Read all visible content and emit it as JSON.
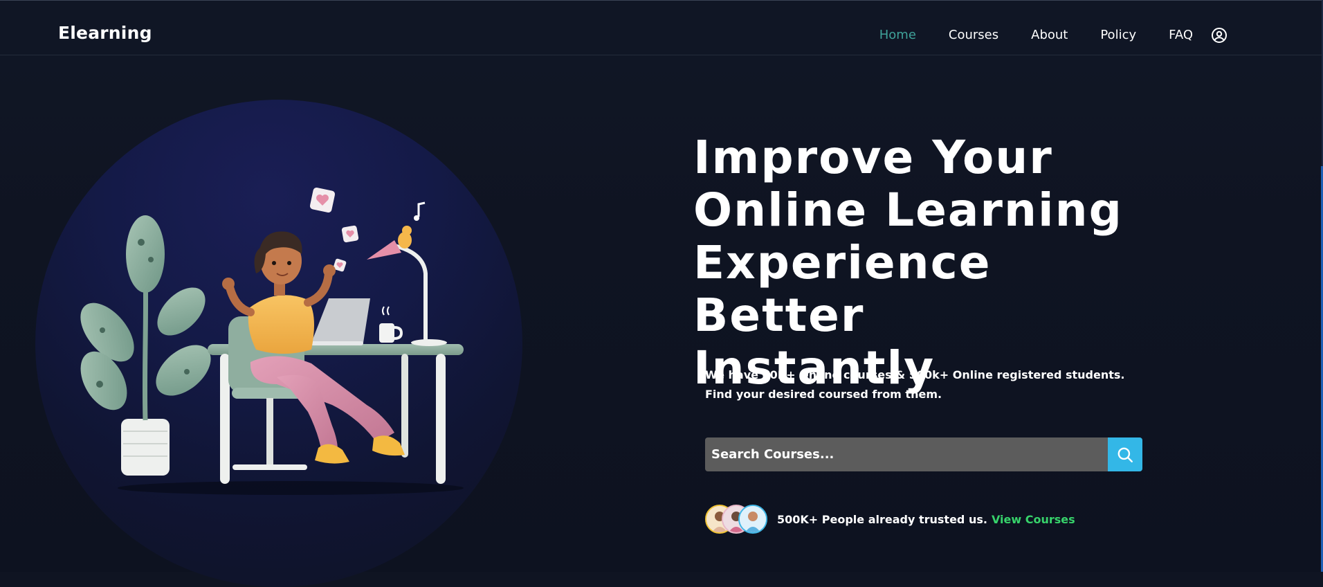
{
  "header": {
    "logo": "Elearning",
    "nav": [
      {
        "label": "Home",
        "active": true
      },
      {
        "label": "Courses",
        "active": false
      },
      {
        "label": "About",
        "active": false
      },
      {
        "label": "Policy",
        "active": false
      },
      {
        "label": "FAQ",
        "active": false
      }
    ],
    "user_icon": "user-circle-icon"
  },
  "hero": {
    "title_lines": [
      "Improve Your",
      "Online Learning",
      "Experience Better",
      "Instantly"
    ],
    "description": "We have 20K+ Online courses & 500k+ Online registered students. Find your desired coursed from them.",
    "search": {
      "placeholder": "Search Courses...",
      "button_icon": "search-icon"
    },
    "trust": {
      "text": "500K+ People already trusted us.",
      "link": "View Courses"
    }
  },
  "colors": {
    "background": "#0f1422",
    "nav_active": "#3fa39a",
    "search_button": "#33b7e7",
    "search_field": "#5c5c5c",
    "link_green": "#37d36b"
  }
}
